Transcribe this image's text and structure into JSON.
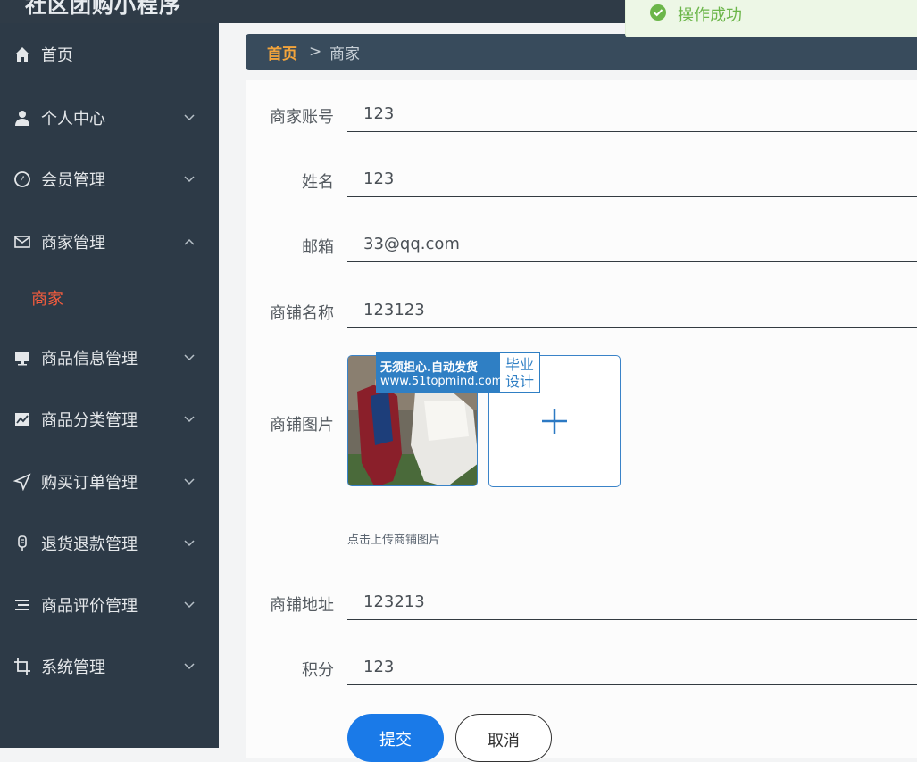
{
  "header": {
    "app_title": "社区团购小程序"
  },
  "toast": {
    "message": "操作成功"
  },
  "sidebar": {
    "items": [
      {
        "label": "首页",
        "icon": "home-icon"
      },
      {
        "label": "个人中心",
        "icon": "person-icon"
      },
      {
        "label": "会员管理",
        "icon": "compass-icon"
      },
      {
        "label": "商家管理",
        "icon": "mail-icon"
      },
      {
        "label": "商品信息管理",
        "icon": "monitor-icon"
      },
      {
        "label": "商品分类管理",
        "icon": "chart-icon"
      },
      {
        "label": "购买订单管理",
        "icon": "send-icon"
      },
      {
        "label": "退货退款管理",
        "icon": "mic-icon"
      },
      {
        "label": "商品评价管理",
        "icon": "list-icon"
      },
      {
        "label": "系统管理",
        "icon": "crop-icon"
      }
    ],
    "submenu_active": "商家"
  },
  "breadcrumb": {
    "home": "首页",
    "separator": ">",
    "current": "商家"
  },
  "form": {
    "fields": [
      {
        "label": "商家账号",
        "value": "123"
      },
      {
        "label": "姓名",
        "value": "123"
      },
      {
        "label": "邮箱",
        "value": "33@qq.com"
      },
      {
        "label": "商铺名称",
        "value": "123123"
      }
    ],
    "image_label": "商铺图片",
    "upload_hint": "点击上传商铺图片",
    "watermark": {
      "line1": "无须担心.自动发货",
      "line2": "www.51topmind.com",
      "tag1": "毕业",
      "tag2": "设计"
    },
    "fields_after": [
      {
        "label": "商铺地址",
        "value": "123213"
      },
      {
        "label": "积分",
        "value": "123"
      }
    ],
    "submit_label": "提交",
    "cancel_label": "取消"
  },
  "colors": {
    "sidebar_bg": "#2d3a47",
    "breadcrumb_bg": "#384b5c",
    "accent_orange": "#f3a43b",
    "active_submenu": "#f25c3e",
    "primary_button": "#1a7ae8",
    "success": "#6cb64a"
  }
}
